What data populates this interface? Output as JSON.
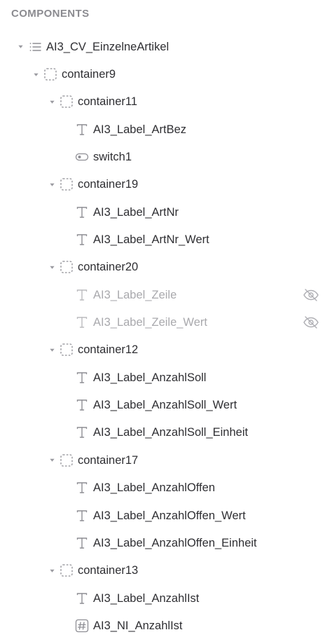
{
  "panel": {
    "title": "COMPONENTS"
  },
  "tree": [
    {
      "label": "AI3_CV_EinzelneArtikel",
      "icon": "list-icon",
      "level": 0,
      "expanded": true,
      "hidden": false
    },
    {
      "label": "container9",
      "icon": "container-icon",
      "level": 1,
      "expanded": true,
      "hidden": false
    },
    {
      "label": "container11",
      "icon": "container-icon",
      "level": 2,
      "expanded": true,
      "hidden": false
    },
    {
      "label": "AI3_Label_ArtBez",
      "icon": "text-icon",
      "level": 3,
      "hidden": false
    },
    {
      "label": "switch1",
      "icon": "switch-icon",
      "level": 3,
      "hidden": false
    },
    {
      "label": "container19",
      "icon": "container-icon",
      "level": 2,
      "expanded": true,
      "hidden": false
    },
    {
      "label": "AI3_Label_ArtNr",
      "icon": "text-icon",
      "level": 3,
      "hidden": false
    },
    {
      "label": "AI3_Label_ArtNr_Wert",
      "icon": "text-icon",
      "level": 3,
      "hidden": false
    },
    {
      "label": "container20",
      "icon": "container-icon",
      "level": 2,
      "expanded": true,
      "hidden": false
    },
    {
      "label": "AI3_Label_Zeile",
      "icon": "text-icon",
      "level": 3,
      "hidden": true
    },
    {
      "label": "AI3_Label_Zeile_Wert",
      "icon": "text-icon",
      "level": 3,
      "hidden": true
    },
    {
      "label": "container12",
      "icon": "container-icon",
      "level": 2,
      "expanded": true,
      "hidden": false
    },
    {
      "label": "AI3_Label_AnzahlSoll",
      "icon": "text-icon",
      "level": 3,
      "hidden": false
    },
    {
      "label": "AI3_Label_AnzahlSoll_Wert",
      "icon": "text-icon",
      "level": 3,
      "hidden": false
    },
    {
      "label": "AI3_Label_AnzahlSoll_Einheit",
      "icon": "text-icon",
      "level": 3,
      "hidden": false
    },
    {
      "label": "container17",
      "icon": "container-icon",
      "level": 2,
      "expanded": true,
      "hidden": false
    },
    {
      "label": "AI3_Label_AnzahlOffen",
      "icon": "text-icon",
      "level": 3,
      "hidden": false
    },
    {
      "label": "AI3_Label_AnzahlOffen_Wert",
      "icon": "text-icon",
      "level": 3,
      "hidden": false
    },
    {
      "label": "AI3_Label_AnzahlOffen_Einheit",
      "icon": "text-icon",
      "level": 3,
      "hidden": false
    },
    {
      "label": "container13",
      "icon": "container-icon",
      "level": 2,
      "expanded": true,
      "hidden": false
    },
    {
      "label": "AI3_Label_AnzahlIst",
      "icon": "text-icon",
      "level": 3,
      "hidden": false
    },
    {
      "label": "AI3_NI_AnzahlIst",
      "icon": "number-input-icon",
      "level": 3,
      "hidden": false
    }
  ],
  "colors": {
    "text": "#2f2f33",
    "muted": "#a9a9ad",
    "title": "#8b8b90",
    "icon": "#8e8e94"
  }
}
